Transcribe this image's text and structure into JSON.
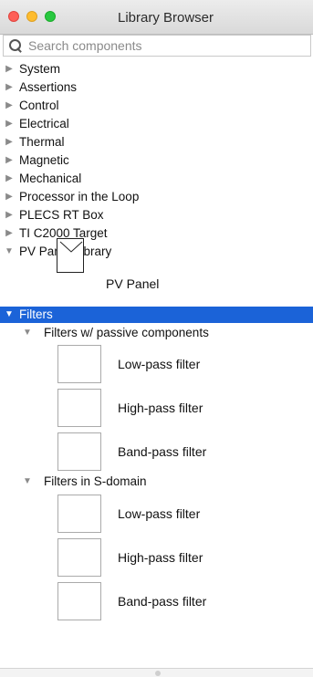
{
  "window": {
    "title": "Library Browser"
  },
  "search": {
    "placeholder": "Search components"
  },
  "tree": {
    "items": [
      {
        "label": "System",
        "expanded": false
      },
      {
        "label": "Assertions",
        "expanded": false
      },
      {
        "label": "Control",
        "expanded": false
      },
      {
        "label": "Electrical",
        "expanded": false
      },
      {
        "label": "Thermal",
        "expanded": false
      },
      {
        "label": "Magnetic",
        "expanded": false
      },
      {
        "label": "Mechanical",
        "expanded": false
      },
      {
        "label": "Processor in the Loop",
        "expanded": false
      },
      {
        "label": "PLECS RT Box",
        "expanded": false
      },
      {
        "label": "TI C2000 Target",
        "expanded": false
      },
      {
        "label": "PV Panel Library",
        "expanded": true
      }
    ],
    "pv_panel": {
      "label": "PV Panel"
    },
    "filters": {
      "label": "Filters",
      "selected": true,
      "passive": {
        "label": "Filters w/ passive components",
        "blocks": [
          "Low-pass filter",
          "High-pass filter",
          "Band-pass filter"
        ]
      },
      "sdomain": {
        "label": "Filters in S-domain",
        "blocks": [
          "Low-pass filter",
          "High-pass filter",
          "Band-pass filter"
        ]
      }
    }
  },
  "icons": {
    "expanded": "▼",
    "collapsed": "▶"
  },
  "colors": {
    "selection": "#1b63d8",
    "close": "#fe5f57",
    "minimize": "#febc2e",
    "zoom": "#28c840"
  }
}
